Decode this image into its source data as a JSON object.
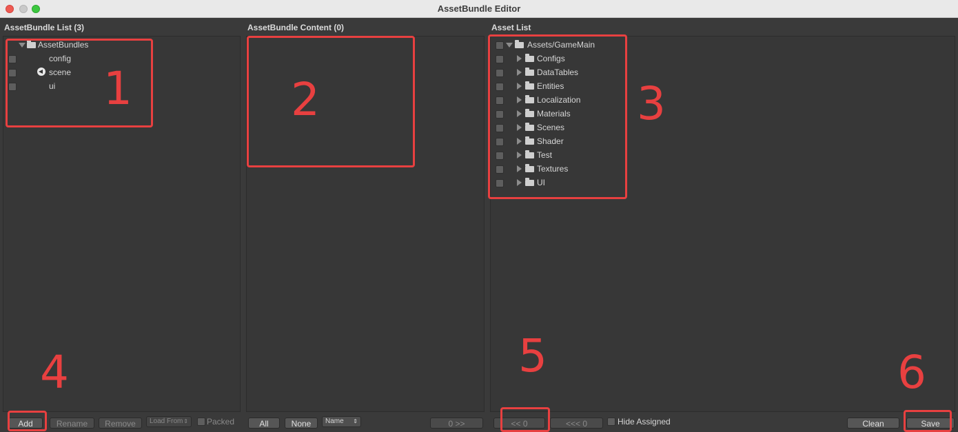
{
  "window": {
    "title": "AssetBundle Editor"
  },
  "columns": {
    "list": "AssetBundle List (3)",
    "content": "AssetBundle Content (0)",
    "assets": "Asset List"
  },
  "bundle_tree": {
    "root": "AssetBundles",
    "items": [
      "config",
      "scene",
      "ui"
    ]
  },
  "asset_tree": {
    "root": "Assets/GameMain",
    "items": [
      "Configs",
      "DataTables",
      "Entities",
      "Localization",
      "Materials",
      "Scenes",
      "Shader",
      "Test",
      "Textures",
      "UI"
    ]
  },
  "left_toolbar": {
    "add": "Add",
    "rename": "Rename",
    "remove": "Remove",
    "load_from": "Load From",
    "packed": "Packed"
  },
  "mid_toolbar": {
    "all": "All",
    "none": "None",
    "sort": "Name",
    "move_right": "0 >>"
  },
  "right_toolbar": {
    "move_left": "<< 0",
    "move_left_all": "<<< 0",
    "hide_assigned": "Hide Assigned",
    "clean": "Clean",
    "save": "Save"
  },
  "annotations": [
    "1",
    "2",
    "3",
    "4",
    "5",
    "6"
  ],
  "colors": {
    "annotation": "#e84040",
    "panel": "#373737",
    "background": "#3a3a3a"
  }
}
